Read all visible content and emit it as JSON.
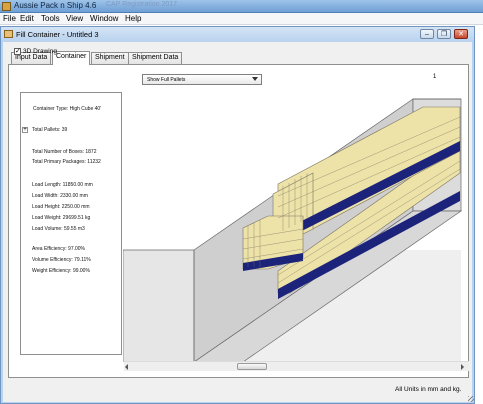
{
  "window": {
    "title": "Aussie Pack n Ship 4.6",
    "ghost_title": "CAP Registration 2017"
  },
  "menu": [
    "File",
    "Edit",
    "Tools",
    "View",
    "Window",
    "Help"
  ],
  "child_window": {
    "title": "Fill Container - Untitled 3"
  },
  "tabs": [
    {
      "label": "Input Data",
      "active": false
    },
    {
      "label": "Container",
      "active": true
    },
    {
      "label": "Shipment",
      "active": false
    },
    {
      "label": "Shipment Data",
      "active": false
    }
  ],
  "drawing_toggle": {
    "label": "3D Drawing",
    "checked": true
  },
  "view_select": {
    "value": "Show Full Pallets"
  },
  "page_number": "1",
  "info": {
    "container_type": "Container Type: High Cube 40'",
    "total_pallets": "Total Pallets: 39",
    "total_boxes": "Total Number of Boxes: 1872",
    "total_primary": "Total Primary Packages: 11232",
    "load_length": "Load Length: 11850.00 mm",
    "load_width": "Load Width: 2330.00 mm",
    "load_height": "Load Height: 2250.00 mm",
    "load_weight": "Load Weight: 29699.51 kg",
    "load_volume": "Load Volume: 59.55 m3",
    "area_eff": "Area Efficiency: 97.00%",
    "volume_eff": "Volume Efficiency: 79.11%",
    "weight_eff": "Weight Efficiency: 99.00%"
  },
  "footer": {
    "units": "All Units in mm and kg."
  },
  "colors": {
    "box": "#ede2a8",
    "box_line": "#7a7460",
    "pallet": "#1c237a",
    "container_wall": "#cfcfcf",
    "container_floor": "#d8d8d8"
  }
}
